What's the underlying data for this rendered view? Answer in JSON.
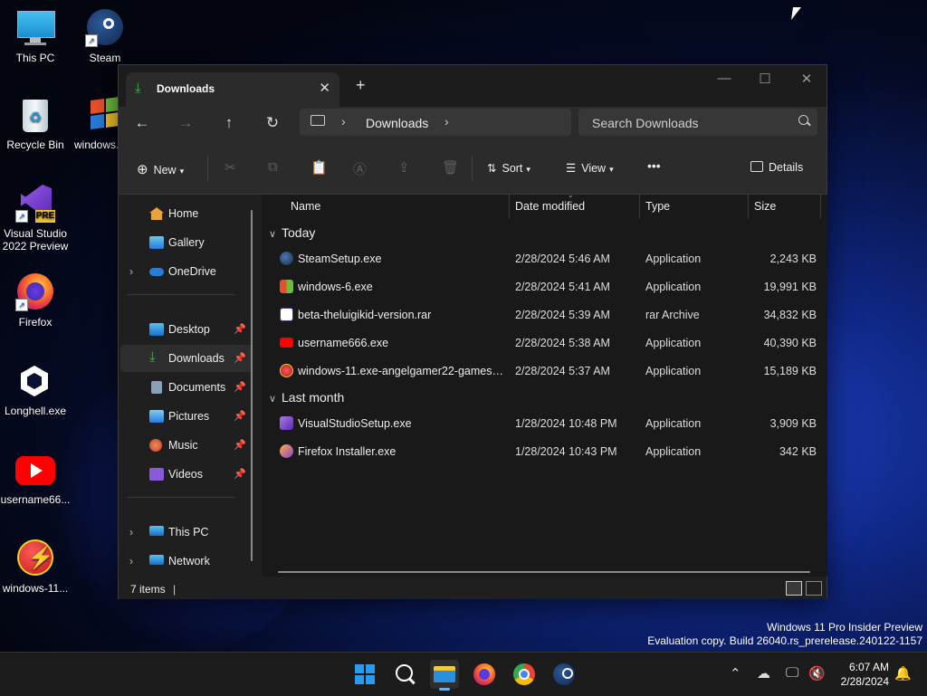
{
  "desktop": {
    "icons": [
      {
        "label": "This PC",
        "icon": "monitor-icon"
      },
      {
        "label": "Steam",
        "icon": "steam-icon"
      },
      {
        "label": "Recycle Bin",
        "icon": "recycle-bin-icon"
      },
      {
        "label": "windows...",
        "icon": "windows-xp-flag-icon"
      },
      {
        "label": "Visual Studio 2022 Preview",
        "icon": "visual-studio-preview-icon",
        "badge": "PRE"
      },
      {
        "label": "Firefox",
        "icon": "firefox-icon"
      },
      {
        "label": "Longhell.exe",
        "icon": "unity-icon"
      },
      {
        "label": "username66...",
        "icon": "youtube-icon"
      },
      {
        "label": "windows-11...",
        "icon": "lightning-bolt-icon"
      }
    ],
    "watermark": {
      "line1": "Windows 11 Pro Insider Preview",
      "line2": "Evaluation copy. Build 26040.rs_prerelease.240122-1157"
    }
  },
  "explorer": {
    "tab_title": "Downloads",
    "new_tab_glyph": "+",
    "breadcrumb": [
      "Downloads"
    ],
    "search_placeholder": "Search Downloads",
    "commands": {
      "new": "New",
      "sort": "Sort",
      "view": "View",
      "more": "•••",
      "details": "Details"
    },
    "nav": {
      "top": [
        {
          "label": "Home",
          "icon": "home-icon",
          "color": "#e8a33d"
        },
        {
          "label": "Gallery",
          "icon": "gallery-icon",
          "color": "#3a8fd8"
        },
        {
          "label": "OneDrive",
          "icon": "onedrive-icon",
          "color": "#2b7cd3",
          "expandable": true
        }
      ],
      "quick": [
        {
          "label": "Desktop",
          "icon": "desktop-icon",
          "color": "#3a8fd8",
          "pinned": true
        },
        {
          "label": "Downloads",
          "icon": "downloads-icon",
          "color": "#3fb950",
          "pinned": true,
          "selected": true
        },
        {
          "label": "Documents",
          "icon": "documents-icon",
          "color": "#8a9fb8",
          "pinned": true
        },
        {
          "label": "Pictures",
          "icon": "pictures-icon",
          "color": "#3a8fd8",
          "pinned": true
        },
        {
          "label": "Music",
          "icon": "music-icon",
          "color": "#e0603a",
          "pinned": true
        },
        {
          "label": "Videos",
          "icon": "videos-icon",
          "color": "#8a5ad8",
          "pinned": true
        }
      ],
      "bottom": [
        {
          "label": "This PC",
          "icon": "this-pc-icon",
          "color": "#3a8fd8",
          "expandable": true
        },
        {
          "label": "Network",
          "icon": "network-icon",
          "color": "#3a8fd8",
          "expandable": true
        }
      ]
    },
    "columns": {
      "name": "Name",
      "date": "Date modified",
      "type": "Type",
      "size": "Size"
    },
    "groups": [
      {
        "label": "Today",
        "files": [
          {
            "name": "SteamSetup.exe",
            "date": "2/28/2024 5:46 AM",
            "type": "Application",
            "size": "2,243 KB",
            "icon": "steam-icon",
            "color": "#1b2838"
          },
          {
            "name": "windows-6.exe",
            "date": "2/28/2024 5:41 AM",
            "type": "Application",
            "size": "19,991 KB",
            "icon": "windows-flag-icon",
            "color": "#e0a020"
          },
          {
            "name": "beta-theluigikid-version.rar",
            "date": "2/28/2024 5:39 AM",
            "type": "rar Archive",
            "size": "34,832 KB",
            "icon": "archive-icon",
            "color": "#ffffff"
          },
          {
            "name": "username666.exe",
            "date": "2/28/2024 5:38 AM",
            "type": "Application",
            "size": "40,390 KB",
            "icon": "youtube-icon",
            "color": "#ff0000"
          },
          {
            "name": "windows-11.exe-angelgamer22-games-e...",
            "date": "2/28/2024 5:37 AM",
            "type": "Application",
            "size": "15,189 KB",
            "icon": "lightning-bolt-icon",
            "color": "#d42020"
          }
        ]
      },
      {
        "label": "Last month",
        "files": [
          {
            "name": "VisualStudioSetup.exe",
            "date": "1/28/2024 10:48 PM",
            "type": "Application",
            "size": "3,909 KB",
            "icon": "visual-studio-icon",
            "color": "#8a5ad8"
          },
          {
            "name": "Firefox Installer.exe",
            "date": "1/28/2024 10:43 PM",
            "type": "Application",
            "size": "342 KB",
            "icon": "firefox-icon",
            "color": "#8a40d8"
          }
        ]
      }
    ],
    "status": {
      "count": "7 items",
      "cursor": "|"
    }
  },
  "taskbar": {
    "apps": [
      "start-icon",
      "search-icon",
      "file-explorer-icon",
      "firefox-icon",
      "chrome-icon",
      "steam-icon"
    ],
    "clock": {
      "time": "6:07 AM",
      "date": "2/28/2024"
    }
  }
}
